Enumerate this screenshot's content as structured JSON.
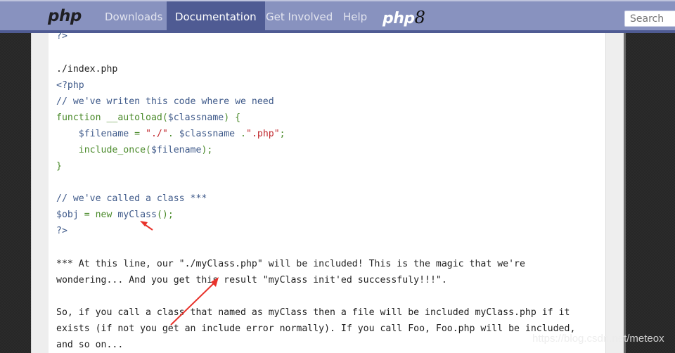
{
  "navbar": {
    "logo": "php",
    "items": [
      {
        "label": "Downloads",
        "active": false
      },
      {
        "label": "Documentation",
        "active": true
      },
      {
        "label": "Get Involved",
        "active": false
      },
      {
        "label": "Help",
        "active": false
      }
    ],
    "php8_logo": "php",
    "php8_version": "8",
    "search_placeholder": "Search"
  },
  "code": {
    "top_partial": "?>",
    "filename": "./index.php",
    "open_tag": "<?php",
    "comment1": "// we've writen this code where we need",
    "func_kw": "function __autoload(",
    "func_var": "$classname",
    "func_end": ") {",
    "assign_var": "    $filename",
    "assign_eq": " = ",
    "str1": "\"./\"",
    "concat1": ". ",
    "assign_var2": "$classname",
    "concat2": " .",
    "str2": "\".php\"",
    "semi": ";",
    "include_fn": "    include_once(",
    "include_var": "$filename",
    "include_end": ");",
    "close_brace": "}",
    "comment2": "// we've called a class ***",
    "obj_var": "$obj",
    "obj_eq": " = ",
    "obj_new": "new ",
    "obj_class": "myClass",
    "obj_end": "();",
    "close_tag": "?>"
  },
  "text": {
    "p1_line1": "*** At this line, our \"./myClass.php\" will be included! This is the magic that we're",
    "p1_line2": "wondering... And you get this result \"myClass init'ed successfuly!!!\".",
    "p2_line1": "So, if you call a class that named as myClass then a file will be included myClass.php if it",
    "p2_line2": "exists (if not you get an include error normally). If you call Foo, Foo.php will be included,",
    "p2_line3": "and so on..."
  },
  "watermark": "https://blog.csdn.net/meteox",
  "colors": {
    "nav_bg": "#8892bf",
    "nav_active": "#4f5b93",
    "annotation_arrow": "#e8322b"
  }
}
